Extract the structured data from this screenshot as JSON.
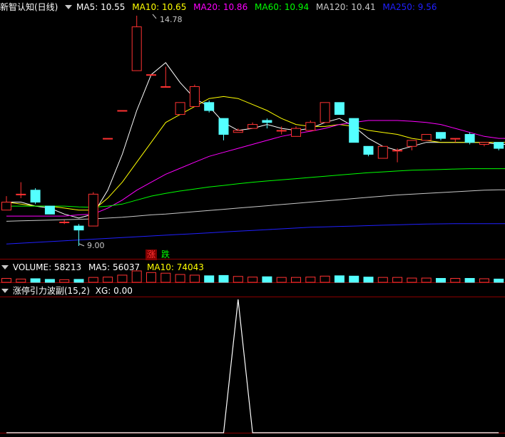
{
  "main": {
    "title": "新智认知(日线)",
    "ma": [
      {
        "label": "MA5: 10.55",
        "color": "#ffffff"
      },
      {
        "label": "MA10: 10.65",
        "color": "#ffff00"
      },
      {
        "label": "MA20: 10.86",
        "color": "#ff00ff"
      },
      {
        "label": "MA60: 10.94",
        "color": "#00ff00"
      },
      {
        "label": "MA120: 10.41",
        "color": "#c8c8c8"
      },
      {
        "label": "MA250: 9.56",
        "color": "#2020ff"
      }
    ],
    "high_label": "14.78",
    "low_label": "9.00",
    "rise_tag": "涨",
    "fall_tag": "跌"
  },
  "volume": {
    "label": "VOLUME: 58213",
    "ma5": "MA5: 56037",
    "ma10": "MA10: 74043"
  },
  "indicator": {
    "label": "涨停引力波副(15,2)",
    "xg": "XG: 0.00"
  },
  "colors": {
    "up": "#ff3232",
    "down": "#54ffff",
    "grid": "#8b0000"
  },
  "chart_data": {
    "type": "candlestick",
    "ylim": [
      9.0,
      14.78
    ],
    "candles": [
      {
        "o": 9.9,
        "c": 10.1,
        "h": 10.25,
        "l": 9.9
      },
      {
        "o": 10.3,
        "c": 10.3,
        "h": 10.6,
        "l": 10.2
      },
      {
        "o": 10.4,
        "c": 10.1,
        "h": 10.45,
        "l": 10.05
      },
      {
        "o": 10.0,
        "c": 9.8,
        "h": 10.0,
        "l": 9.8
      },
      {
        "o": 9.6,
        "c": 9.6,
        "h": 9.65,
        "l": 9.55
      },
      {
        "o": 9.5,
        "c": 9.4,
        "h": 9.55,
        "l": 9.0
      },
      {
        "o": 9.5,
        "c": 10.3,
        "h": 10.35,
        "l": 9.5
      },
      {
        "o": 11.7,
        "c": 11.7,
        "h": 11.7,
        "l": 11.7
      },
      {
        "o": 12.4,
        "c": 12.4,
        "h": 12.4,
        "l": 12.4
      },
      {
        "o": 13.4,
        "c": 14.5,
        "h": 14.78,
        "l": 13.4
      },
      {
        "o": 13.3,
        "c": 13.3,
        "h": 13.3,
        "l": 13.3
      },
      {
        "o": 13.0,
        "c": 13.0,
        "h": 13.5,
        "l": 13.0
      },
      {
        "o": 12.3,
        "c": 12.6,
        "h": 12.6,
        "l": 12.3
      },
      {
        "o": 12.5,
        "c": 13.0,
        "h": 13.05,
        "l": 12.5
      },
      {
        "o": 12.6,
        "c": 12.4,
        "h": 12.65,
        "l": 12.35
      },
      {
        "o": 12.2,
        "c": 11.8,
        "h": 12.2,
        "l": 11.65
      },
      {
        "o": 11.85,
        "c": 11.9,
        "h": 11.95,
        "l": 11.85
      },
      {
        "o": 11.95,
        "c": 12.05,
        "h": 12.1,
        "l": 11.95
      },
      {
        "o": 12.15,
        "c": 12.1,
        "h": 12.2,
        "l": 11.95
      },
      {
        "o": 11.9,
        "c": 11.9,
        "h": 12.0,
        "l": 11.8
      },
      {
        "o": 11.75,
        "c": 11.95,
        "h": 12.0,
        "l": 11.75
      },
      {
        "o": 11.9,
        "c": 12.1,
        "h": 12.15,
        "l": 11.9
      },
      {
        "o": 12.1,
        "c": 12.6,
        "h": 12.6,
        "l": 12.1
      },
      {
        "o": 12.6,
        "c": 12.3,
        "h": 12.6,
        "l": 12.3
      },
      {
        "o": 12.2,
        "c": 11.6,
        "h": 12.2,
        "l": 11.6
      },
      {
        "o": 11.5,
        "c": 11.3,
        "h": 11.5,
        "l": 11.25
      },
      {
        "o": 11.2,
        "c": 11.5,
        "h": 11.5,
        "l": 11.2
      },
      {
        "o": 11.4,
        "c": 11.4,
        "h": 11.45,
        "l": 11.1
      },
      {
        "o": 11.5,
        "c": 11.65,
        "h": 11.65,
        "l": 11.4
      },
      {
        "o": 11.65,
        "c": 11.8,
        "h": 11.8,
        "l": 11.65
      },
      {
        "o": 11.85,
        "c": 11.7,
        "h": 11.85,
        "l": 11.65
      },
      {
        "o": 11.7,
        "c": 11.7,
        "h": 11.7,
        "l": 11.6
      },
      {
        "o": 11.8,
        "c": 11.6,
        "h": 11.85,
        "l": 11.55
      },
      {
        "o": 11.55,
        "c": 11.6,
        "h": 11.6,
        "l": 11.5
      },
      {
        "o": 11.6,
        "c": 11.45,
        "h": 11.6,
        "l": 11.4
      }
    ],
    "series": [
      {
        "name": "MA5",
        "color": "#ffffff",
        "values": [
          10.1,
          10.1,
          10.0,
          9.95,
          9.8,
          9.7,
          9.8,
          10.4,
          11.3,
          12.4,
          13.3,
          13.6,
          13.1,
          12.7,
          12.5,
          12.1,
          11.9,
          11.95,
          12.05,
          11.95,
          11.9,
          11.95,
          12.1,
          12.2,
          12.0,
          11.7,
          11.5,
          11.4,
          11.5,
          11.6,
          11.6,
          11.6,
          11.6,
          11.6,
          11.55
        ]
      },
      {
        "name": "MA10",
        "color": "#ffff00",
        "values": [
          10.1,
          10.05,
          10.0,
          10.0,
          9.95,
          9.9,
          9.9,
          10.2,
          10.6,
          11.1,
          11.6,
          12.1,
          12.3,
          12.5,
          12.7,
          12.75,
          12.7,
          12.55,
          12.4,
          12.2,
          12.05,
          12.0,
          12.0,
          12.05,
          12.0,
          11.9,
          11.85,
          11.8,
          11.7,
          11.65,
          11.6,
          11.6,
          11.6,
          11.6,
          11.6
        ]
      },
      {
        "name": "MA20",
        "color": "#ff00ff",
        "values": [
          9.75,
          9.75,
          9.75,
          9.75,
          9.75,
          9.78,
          9.8,
          9.95,
          10.15,
          10.4,
          10.6,
          10.8,
          10.95,
          11.1,
          11.25,
          11.35,
          11.45,
          11.55,
          11.65,
          11.75,
          11.82,
          11.88,
          11.95,
          12.05,
          12.1,
          12.15,
          12.15,
          12.15,
          12.13,
          12.1,
          12.05,
          11.95,
          11.85,
          11.75,
          11.7
        ]
      },
      {
        "name": "MA60",
        "color": "#00ff00",
        "values": [
          10.0,
          10.0,
          10.0,
          10.0,
          10.0,
          9.98,
          9.97,
          10.0,
          10.05,
          10.15,
          10.25,
          10.32,
          10.38,
          10.43,
          10.48,
          10.52,
          10.56,
          10.6,
          10.63,
          10.66,
          10.69,
          10.72,
          10.75,
          10.78,
          10.81,
          10.84,
          10.86,
          10.88,
          10.9,
          10.91,
          10.92,
          10.93,
          10.94,
          10.94,
          10.94
        ]
      },
      {
        "name": "MA120",
        "color": "#c8c8c8",
        "values": [
          9.62,
          9.63,
          9.64,
          9.65,
          9.66,
          9.67,
          9.68,
          9.7,
          9.72,
          9.75,
          9.78,
          9.8,
          9.83,
          9.86,
          9.89,
          9.92,
          9.95,
          9.98,
          10.01,
          10.04,
          10.07,
          10.1,
          10.13,
          10.16,
          10.19,
          10.22,
          10.25,
          10.28,
          10.3,
          10.32,
          10.34,
          10.36,
          10.38,
          10.4,
          10.41
        ]
      },
      {
        "name": "MA250",
        "color": "#2020ff",
        "values": [
          9.05,
          9.07,
          9.09,
          9.11,
          9.13,
          9.15,
          9.17,
          9.19,
          9.21,
          9.23,
          9.25,
          9.27,
          9.29,
          9.31,
          9.33,
          9.35,
          9.37,
          9.39,
          9.41,
          9.43,
          9.45,
          9.47,
          9.48,
          9.49,
          9.5,
          9.51,
          9.52,
          9.53,
          9.54,
          9.55,
          9.555,
          9.56,
          9.56,
          9.56,
          9.56
        ]
      }
    ],
    "volume": [
      1.2,
      1.0,
      1.1,
      0.9,
      0.8,
      0.9,
      1.5,
      1.6,
      2.2,
      3.5,
      3.0,
      2.8,
      2.4,
      2.2,
      2.0,
      2.1,
      1.8,
      1.6,
      1.7,
      1.5,
      1.5,
      1.6,
      1.9,
      2.0,
      1.9,
      1.6,
      1.5,
      1.5,
      1.3,
      1.3,
      1.2,
      1.2,
      1.2,
      1.1,
      1.0
    ],
    "xg": [
      0,
      0,
      0,
      0,
      0,
      0,
      0,
      0,
      0,
      0,
      0,
      0,
      0,
      0,
      0,
      0,
      1,
      0,
      0,
      0,
      0,
      0,
      0,
      0,
      0,
      0,
      0,
      0,
      0,
      0,
      0,
      0,
      0,
      0,
      0
    ]
  }
}
